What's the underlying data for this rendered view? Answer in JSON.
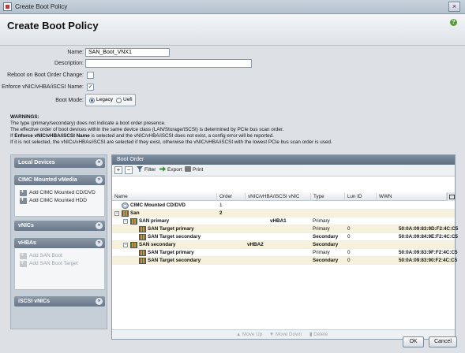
{
  "window": {
    "title": "Create Boot Policy",
    "close_glyph": "×"
  },
  "header": {
    "title": "Create Boot Policy",
    "help_glyph": "?"
  },
  "form": {
    "name_label": "Name:",
    "name_value": "SAN_Boot_VNX1",
    "description_label": "Description:",
    "description_value": "",
    "reboot_label": "Reboot on Boot Order Change:",
    "reboot_checked": false,
    "enforce_label": "Enforce vNIC/vHBA/iSCSI Name:",
    "enforce_checked": true,
    "check_glyph": "✓",
    "bootmode_label": "Boot Mode:",
    "bootmode_options": [
      "Legacy",
      "Uefi"
    ],
    "bootmode_selected": "Legacy"
  },
  "warnings": {
    "title": "WARNINGS:",
    "line1": "The type (primary/secondary) does not indicate a boot order presence.",
    "line2": "The effective order of boot devices within the same device class (LAN/Storage/iSCSI) is determined by PCIe bus scan order.",
    "line3_pre": "If ",
    "line3_bold": "Enforce vNIC/vHBA/iSCSI Name",
    "line3_post": " is selected and the vNIC/vHBA/iSCSI does not exist, a config error will be reported.",
    "line4": "If it is not selected, the vNICs/vHBAs/iSCSI are selected if they exist, otherwise the vNIC/vHBA/iSCSI with the lowest PCIe bus scan order is used."
  },
  "left_panel": {
    "sections": [
      {
        "title": "Local Devices"
      },
      {
        "title": "CIMC Mounted vMedia",
        "items": [
          "Add CIMC Mounted CD/DVD",
          "Add CIMC Mounted HDD"
        ]
      },
      {
        "title": "vNICs"
      },
      {
        "title": "vHBAs",
        "items": [
          "Add SAN Boot",
          "Add SAN Boot Target"
        ]
      },
      {
        "title": "iSCSI vNICs"
      }
    ],
    "chevron_glyph": "»"
  },
  "boot_order": {
    "title": "Boot Order",
    "toolbar": {
      "expand": "+",
      "collapse": "−",
      "filter": "Filter",
      "export": "Export",
      "print": "Print"
    },
    "columns": [
      "Name",
      "Order",
      "vNIC/vHBA/iSCSI vNIC",
      "Type",
      "Lun ID",
      "WWN"
    ],
    "rows": [
      {
        "name": "CIMC Mounted CD/DVD",
        "order": "1",
        "vnic": "",
        "type": "",
        "lun": "",
        "wwn": ""
      },
      {
        "name": "San",
        "order": "2",
        "vnic": "",
        "type": "",
        "lun": "",
        "wwn": ""
      },
      {
        "name": "SAN primary",
        "order": "",
        "vnic": "vHBA1",
        "type": "Primary",
        "lun": "",
        "wwn": ""
      },
      {
        "name": "SAN Target primary",
        "order": "",
        "vnic": "",
        "type": "Primary",
        "lun": "0",
        "wwn": "50:0A:09:83:9D:F2:4C:C5"
      },
      {
        "name": "SAN Target secondary",
        "order": "",
        "vnic": "",
        "type": "Secondary",
        "lun": "0",
        "wwn": "50:0A:09:84:9E:F2:4C:C5"
      },
      {
        "name": "SAN secondary",
        "order": "",
        "vnic": "vHBA2",
        "type": "Secondary",
        "lun": "",
        "wwn": ""
      },
      {
        "name": "SAN Target primary",
        "order": "",
        "vnic": "",
        "type": "Primary",
        "lun": "0",
        "wwn": "50:0A:09:83:9F:F2:4C:C5"
      },
      {
        "name": "SAN Target secondary",
        "order": "",
        "vnic": "",
        "type": "Secondary",
        "lun": "0",
        "wwn": "50:0A:09:83:90:F2:4C:C5"
      }
    ],
    "footer": {
      "move_up": "Move Up",
      "move_down": "Move Down",
      "delete": "Delete"
    }
  },
  "buttons": {
    "ok": "OK",
    "cancel": "Cancel"
  }
}
